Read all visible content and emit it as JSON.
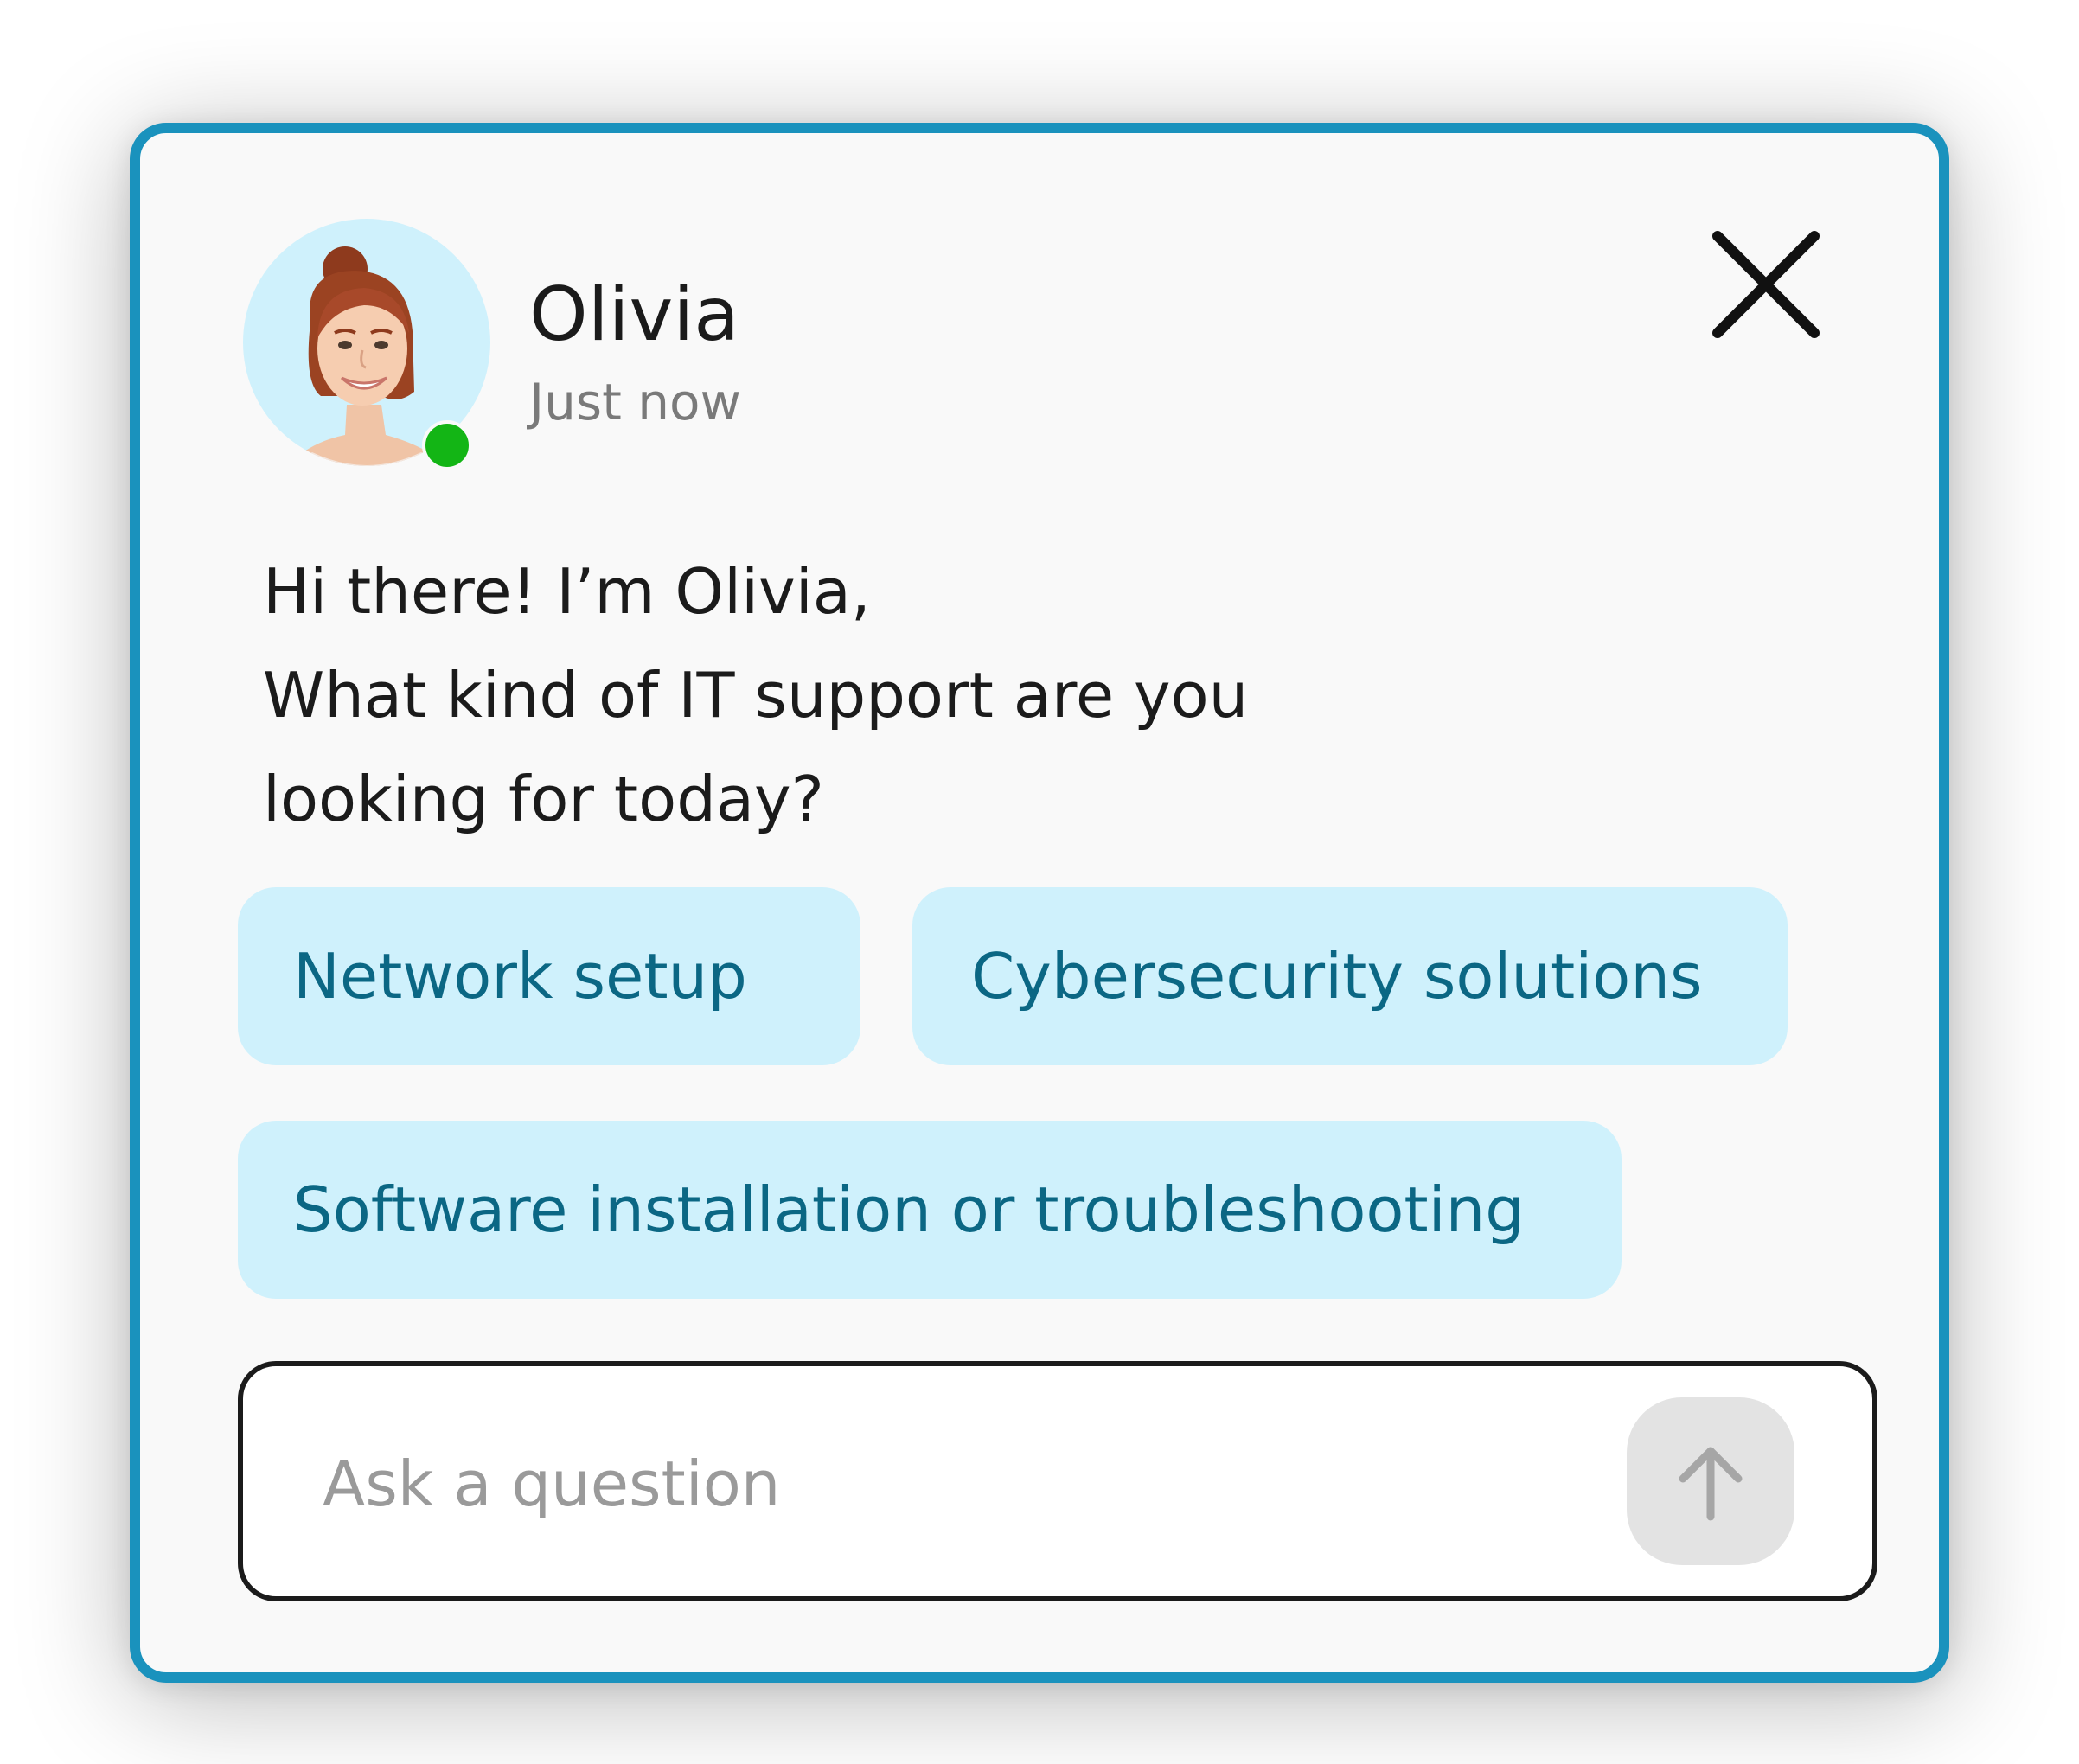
{
  "widget": {
    "accent_color": "#1a92bd",
    "background_color": "#f9f9f9"
  },
  "header": {
    "agent_name": "Olivia",
    "timestamp": "Just now",
    "status": "online",
    "status_color": "#13b515",
    "avatar_icon": "person-avatar",
    "close_icon": "close-icon"
  },
  "message": {
    "lines": [
      "Hi there! I’m Olivia,",
      "What kind of IT support are you",
      "looking for today?"
    ]
  },
  "quick_replies": [
    {
      "label": "Network setup"
    },
    {
      "label": "Cybersecurity solutions"
    },
    {
      "label": "Software installation or troubleshooting"
    }
  ],
  "composer": {
    "placeholder": "Ask a question",
    "value": "",
    "send_icon": "arrow-up-icon"
  }
}
